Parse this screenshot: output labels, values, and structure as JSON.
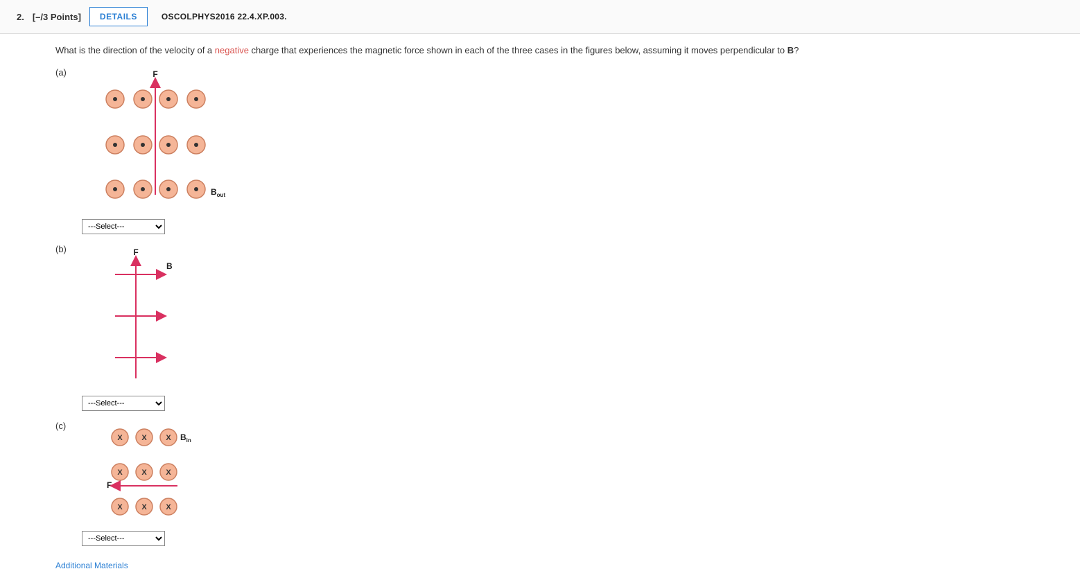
{
  "header": {
    "number": "2.",
    "points": "[–/3 Points]",
    "details_label": "DETAILS",
    "source": "OSCOLPHYS2016 22.4.XP.003."
  },
  "prompt": {
    "prefix": "What is the direction of the velocity of a ",
    "highlight": "negative",
    "middle": " charge that experiences the magnetic force shown in each of the three cases in the figures below, assuming it moves perpendicular to ",
    "bold": "B",
    "suffix": "?"
  },
  "parts": {
    "a": {
      "label": "(a)",
      "f_label": "F",
      "b_label": "B",
      "b_sub": "out"
    },
    "b": {
      "label": "(b)",
      "f_label": "F",
      "b_label": "B"
    },
    "c": {
      "label": "(c)",
      "f_label": "F",
      "b_label": "B",
      "b_sub": "in"
    }
  },
  "select_placeholder": "---Select---",
  "footer": {
    "additional": "Additional Materials"
  }
}
